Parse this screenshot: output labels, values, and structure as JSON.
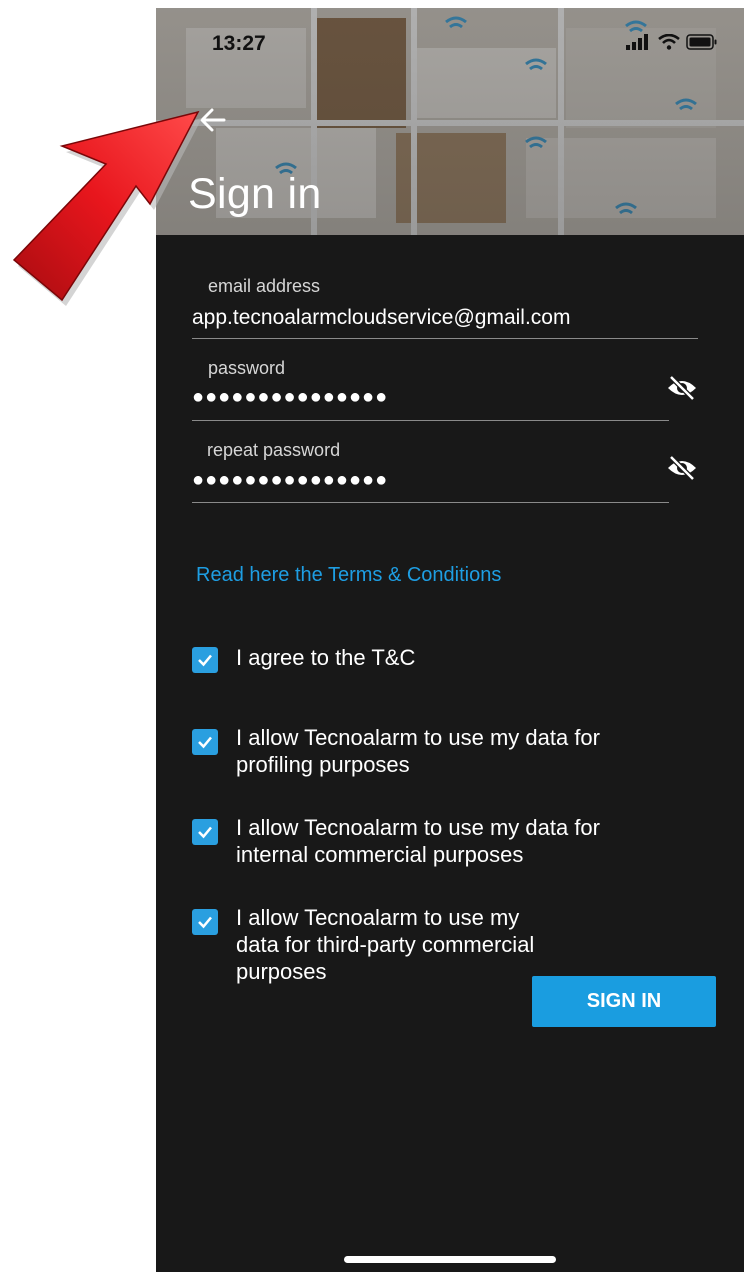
{
  "status_bar": {
    "time": "13:27"
  },
  "header": {
    "title": "Sign in"
  },
  "form": {
    "email": {
      "label": "email address",
      "value": "app.tecnoalarmcloudservice@gmail.com"
    },
    "password": {
      "label": "password",
      "value": "●●●●●●●●●●●●●●●"
    },
    "repeat_password": {
      "label": "repeat password",
      "value": "●●●●●●●●●●●●●●●"
    }
  },
  "terms_link": "Read here the Terms & Conditions",
  "checkboxes": [
    {
      "label": "I agree to the T&C",
      "checked": true
    },
    {
      "label": "I allow Tecnoalarm to use my data for profiling purposes",
      "checked": true
    },
    {
      "label": "I allow Tecnoalarm to use my data for internal commercial purposes",
      "checked": true
    },
    {
      "label": "I allow Tecnoalarm to use my data for third-party commercial purposes",
      "checked": true
    }
  ],
  "sign_in_button": "SIGN IN",
  "colors": {
    "accent": "#1a9de0",
    "background": "#181818",
    "annotation": "#e0161d"
  },
  "icons": [
    "back-arrow-icon",
    "eye-off-icon",
    "checkmark-icon",
    "signal-icon",
    "wifi-icon",
    "battery-icon"
  ]
}
